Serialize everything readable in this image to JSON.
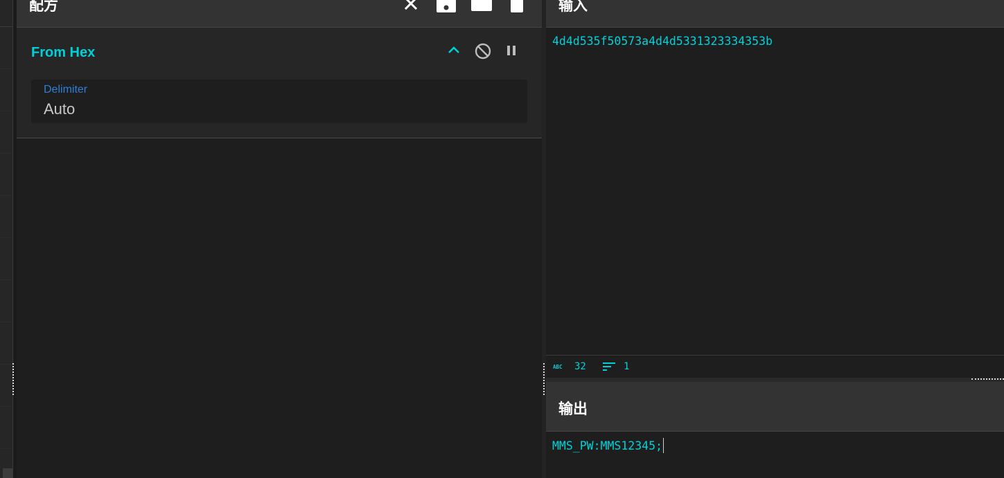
{
  "recipe": {
    "title": "配方",
    "header_buttons": [
      "clear-icon",
      "save-icon",
      "load-icon",
      "bake-icon"
    ],
    "operation": {
      "name": "From Hex",
      "controls": [
        "collapse-icon",
        "disable-icon",
        "pause-icon"
      ],
      "argument": {
        "label": "Delimiter",
        "value": "Auto"
      }
    }
  },
  "input": {
    "title": "输入",
    "text": "4d4d535f50573a4d4d5331323334353b",
    "stats": {
      "length": "32",
      "lines": "1",
      "length_icon": "abc-icon",
      "lines_icon": "lines-icon"
    }
  },
  "output": {
    "title": "输出",
    "text": "MMS_PW:MMS12345;"
  },
  "colors": {
    "accent": "#00d0d8",
    "label_blue": "#2f7fd6",
    "panel_header": "#333333",
    "background": "#1e1e1e"
  }
}
